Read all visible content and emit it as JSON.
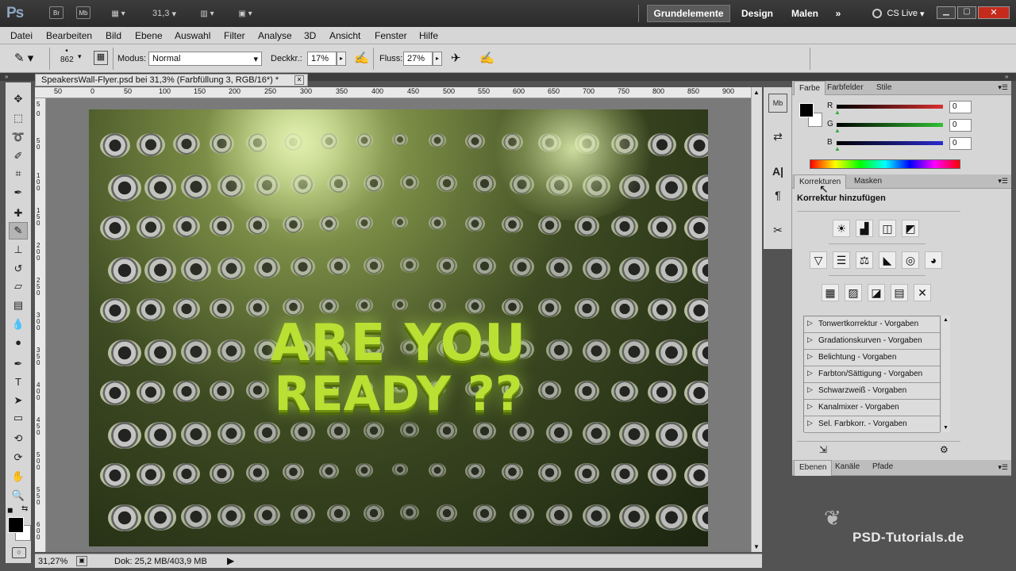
{
  "app": {
    "logo": "Ps"
  },
  "topbar": {
    "mini_bridge": "Br",
    "mini_mb": "Mb",
    "zoom": "31,3",
    "workspaces": [
      "Grundelemente",
      "Design",
      "Malen"
    ],
    "more": "»",
    "cslive": "CS Live"
  },
  "menu": [
    "Datei",
    "Bearbeiten",
    "Bild",
    "Ebene",
    "Auswahl",
    "Filter",
    "Analyse",
    "3D",
    "Ansicht",
    "Fenster",
    "Hilfe"
  ],
  "options": {
    "brush_size": "862",
    "mode_label": "Modus:",
    "mode_value": "Normal",
    "opacity_label": "Deckkr.:",
    "opacity_value": "17%",
    "flow_label": "Fluss:",
    "flow_value": "27%"
  },
  "document": {
    "tab_title": "SpeakersWall-Flyer.psd bei 31,3% (Farbfüllung 3, RGB/16*) *",
    "close": "✕",
    "ruler_top": [
      "50",
      "0",
      "50",
      "100",
      "150",
      "200",
      "250",
      "300",
      "350",
      "400",
      "450",
      "500",
      "550",
      "600",
      "650",
      "700",
      "750",
      "800",
      "850",
      "900"
    ],
    "ruler_left": [
      "5",
      "0",
      "5 0",
      "1 0 0",
      "1 5 0",
      "2 0 0",
      "2 5 0",
      "3 0 0",
      "3 5 0",
      "4 0 0",
      "4 5 0",
      "5 0 0",
      "5 5 0",
      "6 0 0"
    ],
    "headline_1": "ARE YOU",
    "headline_2": "READY ??"
  },
  "status": {
    "zoom": "31,27%",
    "doc": "Dok: 25,2 MB/403,9 MB"
  },
  "color_panel": {
    "tabs": [
      "Farbe",
      "Farbfelder",
      "Stile"
    ],
    "channels": [
      {
        "label": "R",
        "value": "0",
        "color": "#d83030"
      },
      {
        "label": "G",
        "value": "0",
        "color": "#30c030"
      },
      {
        "label": "B",
        "value": "0",
        "color": "#2a2ad0"
      }
    ]
  },
  "adjust_panel": {
    "tabs": [
      "Korrekturen",
      "Masken"
    ],
    "heading": "Korrektur hinzufügen",
    "row1": [
      "☀",
      "▟",
      "◫",
      "◩"
    ],
    "row2": [
      "▽",
      "☰",
      "⚖",
      "◣",
      "◎",
      "◕"
    ],
    "row3": [
      "▦",
      "▨",
      "◪",
      "▤",
      "✕"
    ],
    "presets": [
      "Tonwertkorrektur - Vorgaben",
      "Gradationskurven - Vorgaben",
      "Belichtung - Vorgaben",
      "Farbton/Sättigung - Vorgaben",
      "Schwarzweiß - Vorgaben",
      "Kanalmixer - Vorgaben",
      "Sel. Farbkorr. - Vorgaben"
    ]
  },
  "layers_panel": {
    "tabs": [
      "Ebenen",
      "Kanäle",
      "Pfade"
    ]
  },
  "watermark": "PSD-Tutorials.de"
}
